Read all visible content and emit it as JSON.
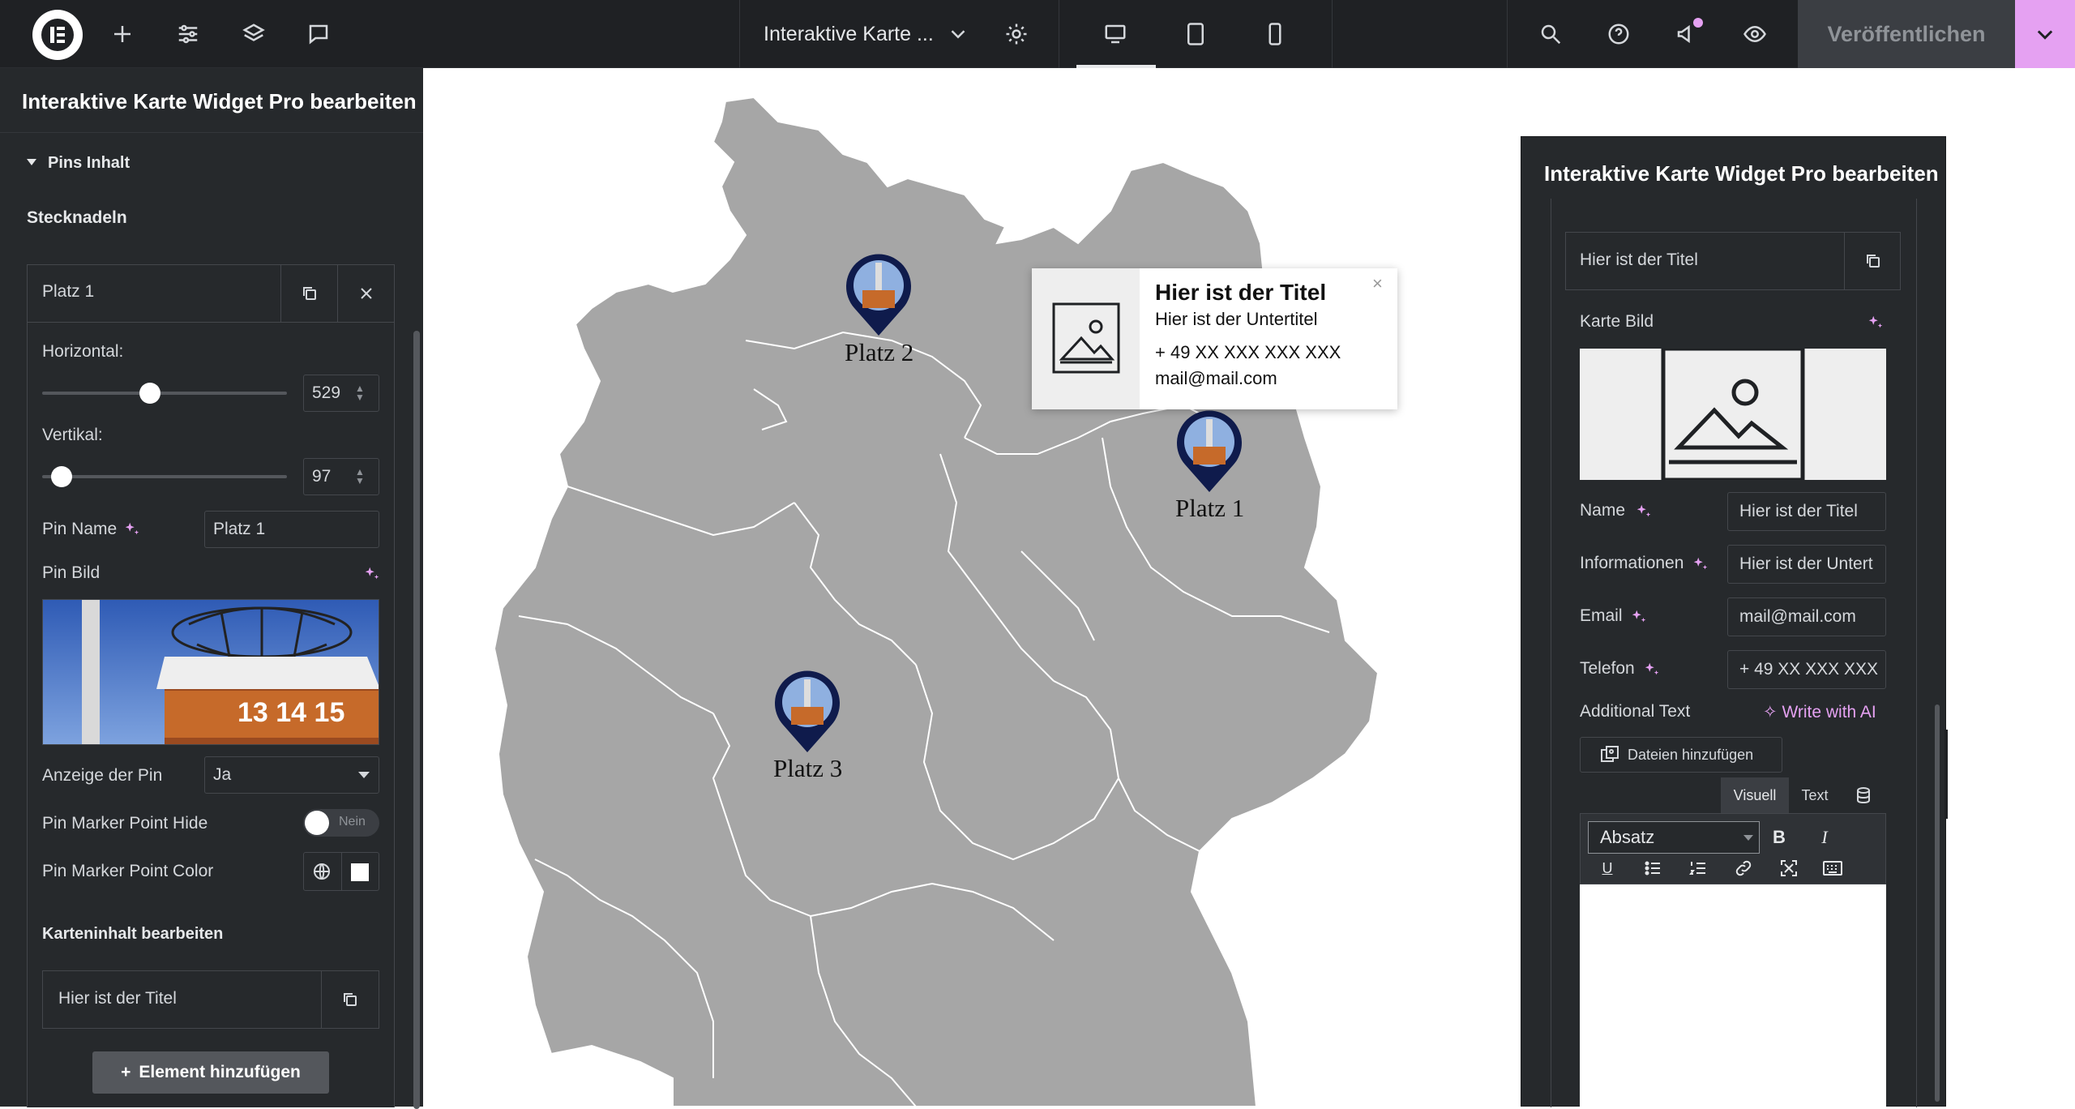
{
  "topbar": {
    "doc_title": "Interaktive Karte ...",
    "publish_label": "Veröffentlichen"
  },
  "left_panel": {
    "title": "Interaktive Karte Widget Pro bearbeiten",
    "section_label": "Pins Inhalt",
    "group_label": "Stecknadeln",
    "item_title": "Platz 1",
    "horizontal_label": "Horizontal:",
    "horizontal_value": "529",
    "horizontal_level": 0.44,
    "vertical_label": "Vertikal:",
    "vertical_value": "97",
    "vertical_level": 0.08,
    "pin_name_label": "Pin Name",
    "pin_name_value": "Platz 1",
    "pin_image_label": "Pin Bild",
    "pin_image_numbers": "13 14 15",
    "display_label": "Anzeige der Pin",
    "display_value": "Ja",
    "marker_hide_label": "Pin Marker Point Hide",
    "marker_hide_value": "Nein",
    "marker_color_label": "Pin Marker Point Color",
    "map_content_label": "Karteninhalt bearbeiten",
    "map_content_item": "Hier ist der Titel",
    "add_button": "Element hinzufügen"
  },
  "map": {
    "pins": [
      {
        "label": "Platz 2"
      },
      {
        "label": "Platz 1"
      },
      {
        "label": "Platz 3"
      }
    ],
    "popup": {
      "title": "Hier ist der Titel",
      "subtitle": "Hier ist der Untertitel",
      "phone": "+ 49 XX XXX XXX XXX",
      "email": "mail@mail.com"
    }
  },
  "right_panel": {
    "title": "Interaktive Karte Widget Pro bearbeiten",
    "item_title": "Hier ist der Titel",
    "image_label": "Karte Bild",
    "name_label": "Name",
    "name_value": "Hier ist der Titel",
    "info_label": "Informationen",
    "info_value": "Hier ist der Untert",
    "email_label": "Email",
    "email_value": "mail@mail.com",
    "phone_label": "Telefon",
    "phone_value": "+ 49 XX XXX XXX",
    "additional_label": "Additional Text",
    "write_ai": "Write with AI",
    "add_files": "Dateien hinzufügen",
    "tab_visual": "Visuell",
    "tab_text": "Text",
    "format_value": "Absatz",
    "bold": "B",
    "italic": "I",
    "underline": "U"
  },
  "colors": {
    "accent_pink": "#e5a1f2",
    "pin_navy": "#0f1b4c",
    "map_gray": "#a6a6a6"
  }
}
